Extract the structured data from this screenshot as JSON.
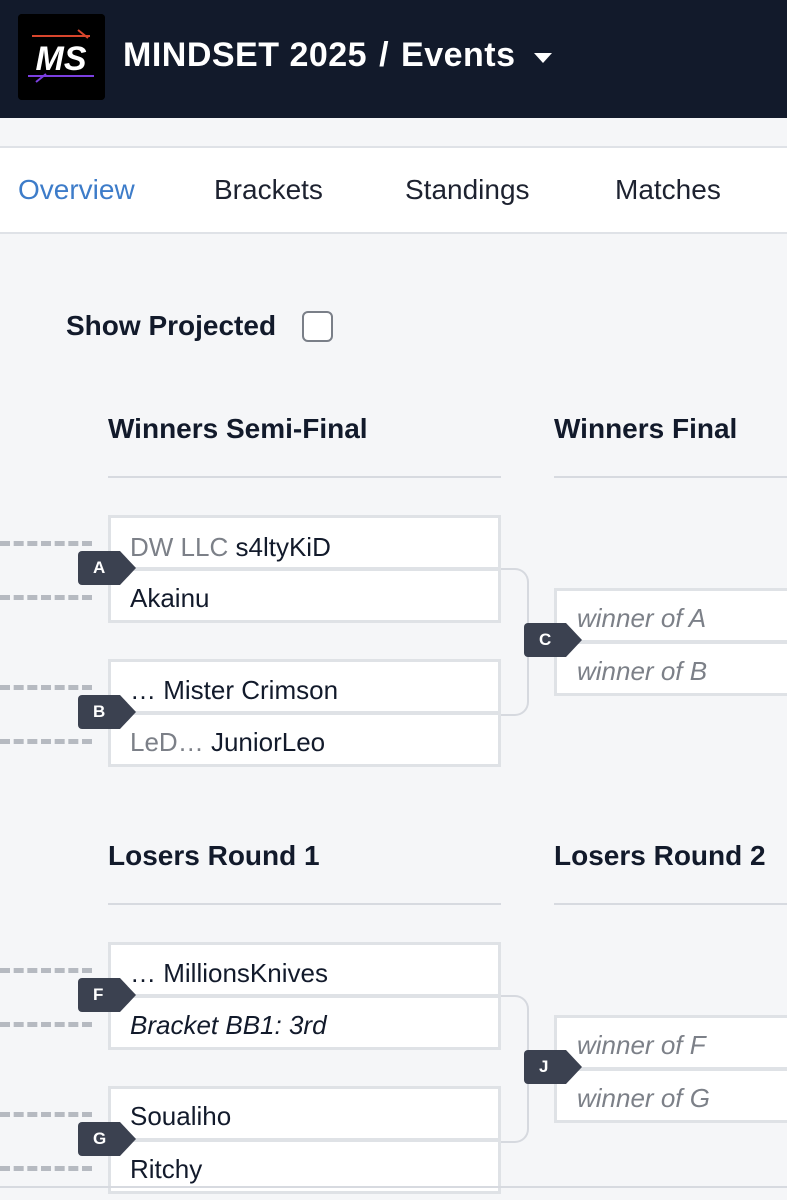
{
  "header": {
    "logo_text": "MS",
    "event_name": "MINDSET 2025",
    "separator": "/",
    "section": "Events",
    "brand_colors": {
      "bar": "#121a2b",
      "accent": "#3d7cc9"
    }
  },
  "tabs": [
    {
      "label": "Overview",
      "active": true
    },
    {
      "label": "Brackets"
    },
    {
      "label": "Standings"
    },
    {
      "label": "Matches"
    }
  ],
  "show_projected": {
    "label": "Show Projected",
    "checked": false
  },
  "rounds": {
    "winners_semi": "Winners Semi-Final",
    "winners_final": "Winners Final",
    "losers_r1": "Losers Round 1",
    "losers_r2": "Losers Round 2"
  },
  "matches": {
    "A": {
      "id": "A",
      "p1_tag": "DW LLC",
      "p1_name": "s4ltyKiD",
      "p2_name": "Akainu"
    },
    "B": {
      "id": "B",
      "p1_tag": "…",
      "p1_name": "Mister Crimson",
      "p2_tag": "LeD…",
      "p2_name": "JuniorLeo"
    },
    "C": {
      "id": "C",
      "p1": "winner of A",
      "p2": "winner of B"
    },
    "F": {
      "id": "F",
      "p1_tag": "…",
      "p1_name": "MillionsKnives",
      "p2": "Bracket BB1: 3rd"
    },
    "G": {
      "id": "G",
      "p1_name": "Soualiho",
      "p2_name": "Ritchy"
    },
    "J": {
      "id": "J",
      "p1": "winner of F",
      "p2": "winner of G"
    }
  }
}
